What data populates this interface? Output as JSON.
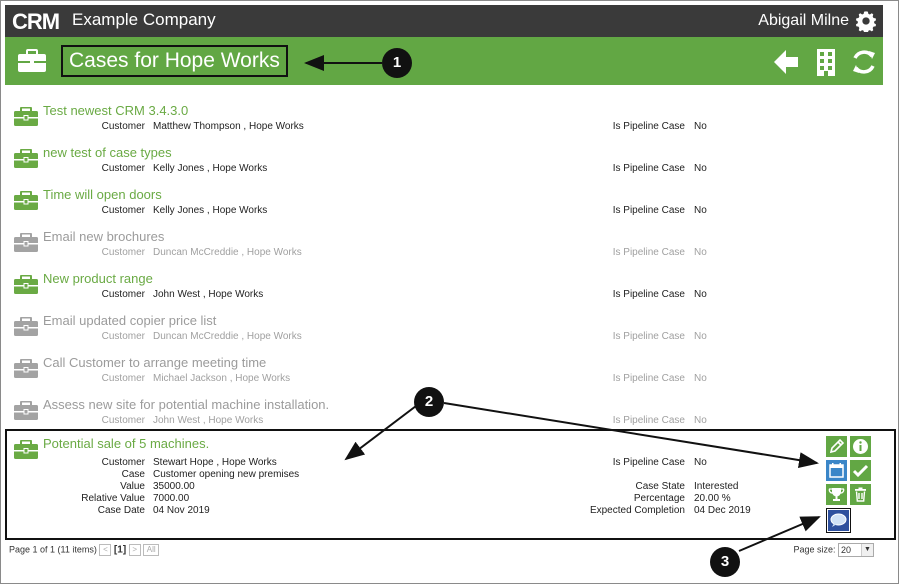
{
  "app": {
    "logo_text": "CRM",
    "company": "Example Company",
    "user": "Abigail Milne"
  },
  "header": {
    "title": "Cases for Hope Works"
  },
  "labels": {
    "customer": "Customer",
    "pipeline": "Is Pipeline Case",
    "case": "Case",
    "value": "Value",
    "relative_value": "Relative Value",
    "case_date": "Case Date",
    "case_state": "Case State",
    "percentage": "Percentage",
    "expected_completion": "Expected Completion"
  },
  "cases": [
    {
      "title": "Test newest CRM 3.4.3.0",
      "customer": "Matthew Thompson , Hope Works",
      "pipeline": "No",
      "active": true
    },
    {
      "title": "new test of case types",
      "customer": "Kelly Jones , Hope Works",
      "pipeline": "No",
      "active": true
    },
    {
      "title": "Time will open doors",
      "customer": "Kelly Jones , Hope Works",
      "pipeline": "No",
      "active": true
    },
    {
      "title": "Email new brochures",
      "customer": "Duncan McCreddie , Hope Works",
      "pipeline": "No",
      "active": false
    },
    {
      "title": "New product range",
      "customer": "John West , Hope Works",
      "pipeline": "No",
      "active": true
    },
    {
      "title": "Email updated copier price list",
      "customer": "Duncan McCreddie , Hope Works",
      "pipeline": "No",
      "active": false
    },
    {
      "title": "Call Customer to arrange meeting time",
      "customer": "Michael Jackson , Hope Works",
      "pipeline": "No",
      "active": false
    },
    {
      "title": "Assess new site for potential machine installation.",
      "customer": "John West , Hope Works",
      "pipeline": "No",
      "active": false
    }
  ],
  "selected": {
    "title": "Potential sale of 5 machines.",
    "customer": "Stewart Hope , Hope Works",
    "pipeline": "No",
    "case": "Customer opening new premises",
    "value": "35000.00",
    "relative_value": "7000.00",
    "case_date": "04 Nov 2019",
    "case_state": "Interested",
    "percentage": "20.00 %",
    "expected_completion": "04 Dec 2019"
  },
  "footer": {
    "page_info": "Page 1 of 1 (11 items)",
    "prev": "<",
    "current": "[1]",
    "next": ">",
    "all": "All",
    "page_size_label": "Page size:",
    "page_size": "20"
  },
  "callouts": [
    "1",
    "2",
    "3"
  ],
  "colors": {
    "topbar": "#3a3a3a",
    "brand_green": "#62a744",
    "active_title": "#6aaa44",
    "inactive": "#9b9b9b",
    "chat_button": "#2d4f9e"
  }
}
